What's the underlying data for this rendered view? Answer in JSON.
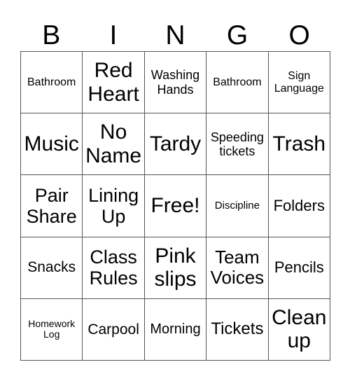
{
  "header": [
    "B",
    "I",
    "N",
    "G",
    "O"
  ],
  "cells": [
    [
      "Bathroom",
      "Red Heart",
      "Washing Hands",
      "Bathroom",
      "Sign Language"
    ],
    [
      "Music",
      "No Name",
      "Tardy",
      "Speeding tickets",
      "Trash"
    ],
    [
      "Pair Share",
      "Lining Up",
      "Free!",
      "Discipline",
      "Folders"
    ],
    [
      "Snacks",
      "Class Rules",
      "Pink slips",
      "Team Voices",
      "Pencils"
    ],
    [
      "Homework Log",
      "Carpool",
      "Morning",
      "Tickets",
      "Clean up"
    ]
  ]
}
